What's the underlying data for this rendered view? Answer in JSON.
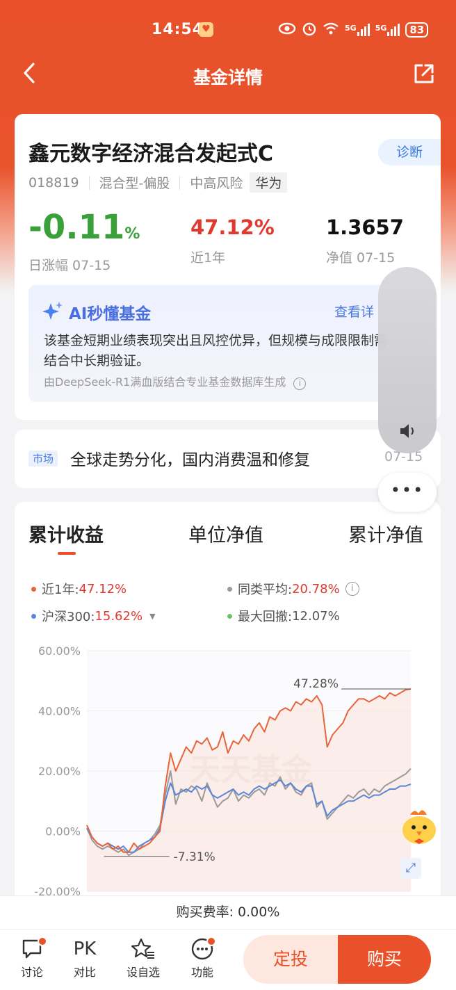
{
  "status_bar": {
    "time": "14:54",
    "battery": "83",
    "signal_1": "5G",
    "signal_2": "5G"
  },
  "nav": {
    "title": "基金详情"
  },
  "fund": {
    "name": "鑫元数字经济混合发起式C",
    "diagnose_label": "诊断",
    "code": "018819",
    "type": "混合型-偏股",
    "risk": "中高风险",
    "tag": "华为",
    "daily_change_value": "-0.11",
    "daily_change_unit": "%",
    "daily_change_label": "日涨幅 07-15",
    "year_return_value": "47.12%",
    "year_return_label": "近1年",
    "nav_value": "1.3657",
    "nav_label": "净值 07-15"
  },
  "ai": {
    "title": "AI秒懂基金",
    "more": "查看详",
    "text": "该基金短期业绩表现突出且风控优异，但规模与成限限制需结合中长期验证。",
    "source": "由DeepSeek-R1满血版结合专业基金数据库生成"
  },
  "market": {
    "tag": "市场",
    "text": "全球走势分化，国内消费温和修复",
    "date": "07-15"
  },
  "tabs": [
    "累计收益",
    "单位净值",
    "累计净值"
  ],
  "legend": {
    "fund_label": "近1年:",
    "fund_value": "47.12%",
    "avg_label": "同类平均:",
    "avg_value": "20.78%",
    "index_label": "沪深300:",
    "index_value": "15.62%",
    "drawdown_label": "最大回撤:",
    "drawdown_value": "12.07%"
  },
  "chart_data": {
    "type": "line",
    "ylim": [
      -20,
      60
    ],
    "yticks": [
      "60.00%",
      "40.00%",
      "20.00%",
      "0.00%",
      "-20.00%"
    ],
    "max_annotation": "47.28%",
    "min_annotation": "-7.31%",
    "watermark": "天天基金",
    "series": [
      {
        "name": "近1年",
        "color": "#e8643a",
        "values": [
          2,
          -2,
          -4,
          -5,
          -4,
          -6,
          -5,
          -7,
          -7,
          -4,
          -6,
          -5,
          -4,
          -2,
          0,
          15,
          26,
          20,
          24,
          28,
          26,
          30,
          29,
          31,
          27,
          28,
          33,
          26,
          30,
          29,
          32,
          30,
          34,
          36,
          33,
          38,
          37,
          40,
          41,
          40,
          43,
          42,
          44,
          43,
          45,
          42,
          28,
          32,
          34,
          36,
          40,
          42,
          44,
          44,
          43,
          44,
          45,
          44,
          46,
          45,
          46,
          47,
          47.28
        ]
      },
      {
        "name": "同类平均",
        "color": "#9a9a9a",
        "values": [
          1,
          -3,
          -5,
          -6,
          -5,
          -6,
          -7,
          -6,
          -8,
          -7,
          -6,
          -4,
          -3,
          -1,
          2,
          12,
          20,
          9,
          14,
          13,
          15,
          14,
          10,
          16,
          12,
          8,
          10,
          11,
          14,
          10,
          12,
          11,
          13,
          14,
          12,
          16,
          15,
          18,
          14,
          16,
          13,
          12,
          15,
          16,
          8,
          10,
          4,
          6,
          8,
          10,
          12,
          11,
          13,
          14,
          12,
          14,
          13,
          15,
          16,
          17,
          18,
          19,
          20.78
        ]
      },
      {
        "name": "沪深300",
        "color": "#5b86d8",
        "values": [
          1,
          -2,
          -4,
          -5,
          -4,
          -5,
          -6,
          -5,
          -7,
          -7,
          -5,
          -4,
          -3,
          -2,
          1,
          10,
          16,
          12,
          13,
          14,
          13,
          15,
          14,
          15,
          12,
          11,
          12,
          13,
          14,
          12,
          13,
          12,
          14,
          15,
          14,
          15,
          16,
          17,
          15,
          16,
          14,
          13,
          15,
          15,
          9,
          10,
          5,
          7,
          8,
          9,
          10,
          10,
          11,
          12,
          11,
          12,
          12,
          13,
          14,
          14,
          15,
          15,
          15.62
        ]
      }
    ]
  },
  "fee": {
    "label": "购买费率: 0.00%"
  },
  "bottom": {
    "discuss": "讨论",
    "pk_icon": "PK",
    "compare": "对比",
    "watchlist": "设自选",
    "functions": "功能",
    "dingtou": "定投",
    "buy": "购买"
  }
}
